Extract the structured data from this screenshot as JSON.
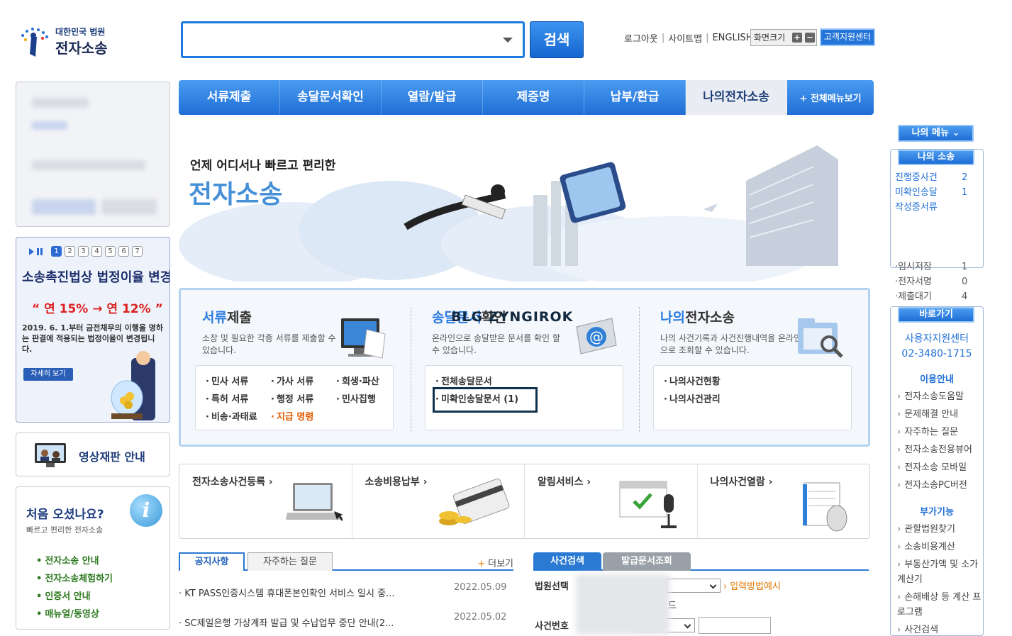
{
  "header": {
    "logo_small": "대한민국 법원",
    "logo_big": "전자소송",
    "search_button": "검색",
    "search_value": "",
    "links": [
      "로그아웃",
      "사이트맵",
      "ENGLISH"
    ],
    "font_size_label": "화면크기",
    "font_plus": "+",
    "font_minus": "−",
    "help_center": "고객지원센터"
  },
  "nav": {
    "items": [
      "서류제출",
      "송달문서확인",
      "열람/발급",
      "제증명",
      "납부/환급",
      "나의전자소송"
    ],
    "all_menu": "+ 전체메뉴보기"
  },
  "hero": {
    "subtitle": "언제 어디서나 빠르고 편리한",
    "title": "전자소송"
  },
  "left": {
    "promo_pages": [
      "1",
      "2",
      "3",
      "4",
      "5",
      "6",
      "7"
    ],
    "promo_title": "소송촉진법상 법정이율 변경",
    "promo_rate": "“ 연 15% → 연 12% ”",
    "promo_text": "2019. 6. 1.부터 금전채무의 이행을 명하는 판결에 적용되는 법정이율이 변경됩니다.",
    "promo_button": "자세히 보기",
    "video_label": "영상재판 안내",
    "first_title": "처음 오셨나요?",
    "first_sub": "빠르고 편리한 전자소송",
    "first_links": [
      "전자소송 안내",
      "전자소송체험하기",
      "인증서 안내",
      "매뉴얼/동영상"
    ]
  },
  "services": [
    {
      "title_hl": "서류",
      "title_rest": "제출",
      "desc": "소장 및 필요한 각종 서류를 제출할 수 있습니다.",
      "links": [
        "민사 서류",
        "가사 서류",
        "회생·파산",
        "특허 서류",
        "행정 서류",
        "민사집행",
        "비송·과태료",
        "지급 명령"
      ]
    },
    {
      "title_hl": "송달문서",
      "title_rest": "확인",
      "desc": "온라인으로 송달받은 문서를 확인 할 수 있습니다.",
      "links": [
        "전체송달문서",
        "미확인송달문서 (1)"
      ]
    },
    {
      "title_hl": "나의",
      "title_rest": "전자소송",
      "desc": "나의 사건기록과 사건진행내역을 온라인으로 조회할 수 있습니다.",
      "links": [
        "나의사건현황",
        "나의사건관리"
      ]
    }
  ],
  "watermark": "BLG ZYNGIROK",
  "quick": [
    "전자소송사건등록 ›",
    "소송비용납부 ›",
    "알림서비스 ›",
    "나의사건열람 ›"
  ],
  "notice": {
    "tabs": [
      "공지사항",
      "자주하는 질문"
    ],
    "more": "더보기",
    "items": [
      {
        "text": "· KT PASS인증시스템 휴대폰본인확인 서비스 일시 중...",
        "date": "2022.05.09"
      },
      {
        "text": "· SC제일은행 가상계좌 발급 및 수납업무 중단 안내(2...",
        "date": "2022.05.02"
      }
    ]
  },
  "case_search": {
    "tabs": [
      "사건검색",
      "발급문서조회"
    ],
    "court_label": "법원선택",
    "example_link": "입력방법예시",
    "case_label": "사건번호",
    "stray": "드"
  },
  "right": {
    "my_menu": "나의 메뉴 ⌄",
    "my_case": "나의 소송",
    "cases": [
      {
        "label": "진행중사건",
        "count": "2"
      },
      {
        "label": "미확인송달",
        "count": "1"
      },
      {
        "label": "작성중서류",
        "count": ""
      }
    ],
    "cases2": [
      {
        "label": "·임시저장",
        "count": "1"
      },
      {
        "label": "·전자서명",
        "count": "0"
      },
      {
        "label": "·제출대기",
        "count": "4"
      }
    ],
    "shortcut": "바로가기",
    "support_center": "사용자지원센터",
    "phone": "02-3480-1715",
    "usage_title": "이용안내",
    "usage_items": [
      "전자소송도움말",
      "문제해결 안내",
      "자주하는 질문",
      "전자소송전용뷰어",
      "전자소송 모바일",
      "전자소송PC버전"
    ],
    "extra_title": "부가기능",
    "extra_items": [
      "관할법원찾기",
      "소송비용계산",
      "부동산가액 및 소가계산기",
      "손해배상 등 계산 프로그램",
      "사건검색"
    ]
  }
}
